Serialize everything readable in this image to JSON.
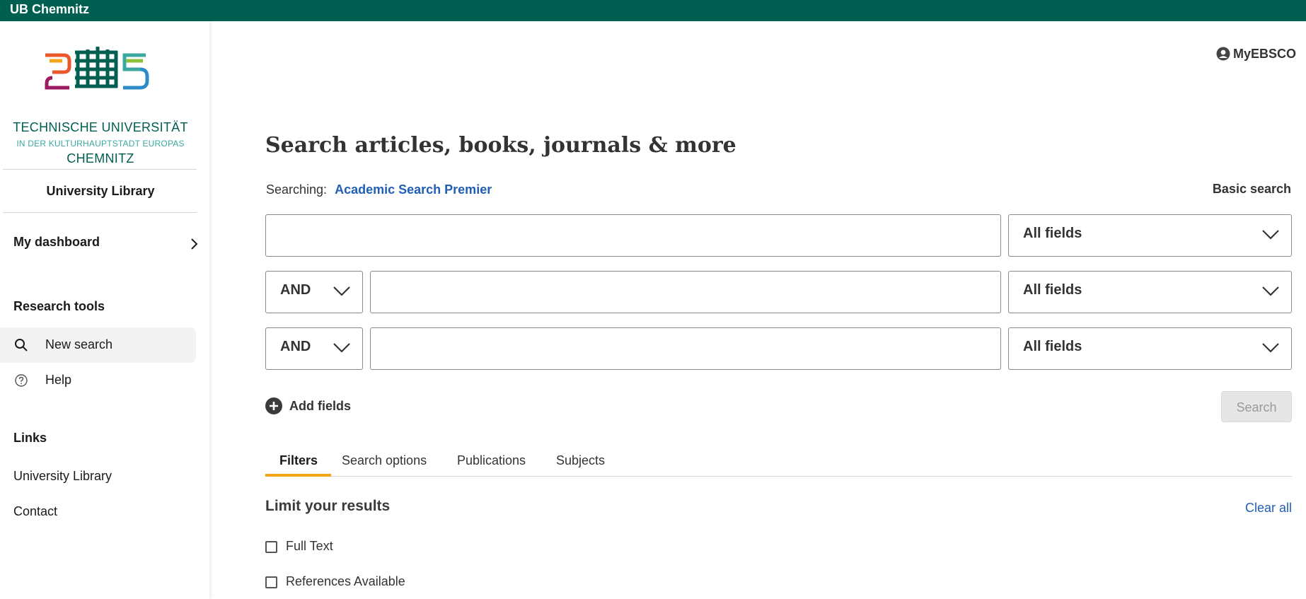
{
  "topbar": {
    "brand": "UB Chemnitz"
  },
  "logo": {
    "line1": "TECHNISCHE UNIVERSITÄT",
    "line2": "IN DER KULTURHAUPTSTADT EUROPAS",
    "line3": "CHEMNITZ",
    "colors": [
      "#e8582a",
      "#f2a518",
      "#9b1c62",
      "#005f50",
      "#3aa8a0",
      "#8bbf3c",
      "#2e8bc9"
    ]
  },
  "sidebar": {
    "institution": "University Library",
    "dashboard": "My dashboard",
    "research_tools_heading": "Research tools",
    "research_tools": [
      {
        "label": "New search",
        "icon": "search-icon",
        "active": true
      },
      {
        "label": "Help",
        "icon": "help-icon",
        "active": false
      }
    ],
    "links_heading": "Links",
    "links": [
      "University Library",
      "Contact"
    ]
  },
  "header": {
    "myebsco": "MyEBSCO"
  },
  "main": {
    "title": "Search articles, books, journals & more",
    "searching_label": "Searching:",
    "database": "Academic Search Premier",
    "basic_search": "Basic search",
    "rows": [
      {
        "operator": null,
        "value": "",
        "field": "All fields"
      },
      {
        "operator": "AND",
        "value": "",
        "field": "All fields"
      },
      {
        "operator": "AND",
        "value": "",
        "field": "All fields"
      }
    ],
    "add_fields": "Add fields",
    "search_button": "Search",
    "tabs": [
      "Filters",
      "Search options",
      "Publications",
      "Subjects"
    ],
    "active_tab": "Filters",
    "limit_heading": "Limit your results",
    "clear_all": "Clear all",
    "checkboxes": [
      {
        "label": "Full Text",
        "checked": false
      },
      {
        "label": "References Available",
        "checked": false
      }
    ]
  },
  "colors": {
    "brand_green": "#005f50",
    "link_blue": "#1f5fb5",
    "tab_accent": "#f2a518"
  }
}
